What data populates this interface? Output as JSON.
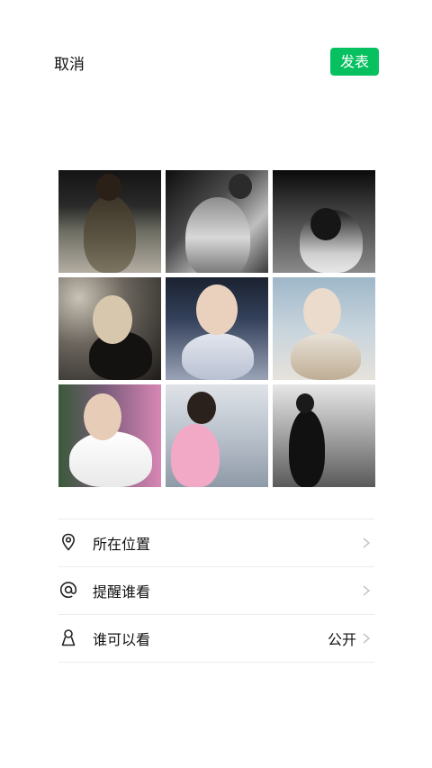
{
  "header": {
    "cancel_label": "取消",
    "publish_label": "发表"
  },
  "colors": {
    "accent": "#07c160",
    "text": "#111111",
    "divider": "#ececec",
    "chevron": "#c7c7c7"
  },
  "photos": [
    {
      "name": "photo-1"
    },
    {
      "name": "photo-2"
    },
    {
      "name": "photo-3"
    },
    {
      "name": "photo-4"
    },
    {
      "name": "photo-5"
    },
    {
      "name": "photo-6"
    },
    {
      "name": "photo-7"
    },
    {
      "name": "photo-8"
    },
    {
      "name": "photo-9"
    }
  ],
  "options": [
    {
      "icon": "location-pin-icon",
      "label": "所在位置",
      "value": ""
    },
    {
      "icon": "at-sign-icon",
      "label": "提醒谁看",
      "value": ""
    },
    {
      "icon": "person-icon",
      "label": "谁可以看",
      "value": "公开"
    }
  ]
}
